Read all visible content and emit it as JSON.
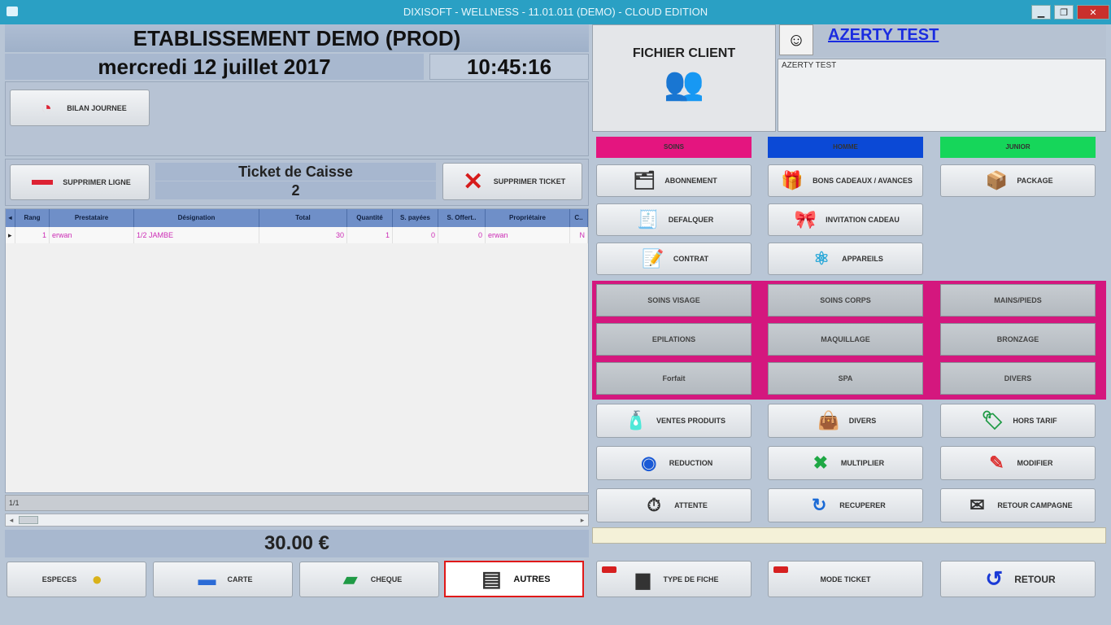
{
  "window": {
    "title": "DIXISOFT - WELLNESS - 11.01.011 (DEMO) - CLOUD EDITION",
    "minimize_icon": "minimize-icon",
    "maximize_icon": "maximize-icon",
    "close_icon": "close-icon"
  },
  "header": {
    "establishment": "ETABLISSEMENT DEMO (PROD)",
    "date": "mercredi 12 juillet 2017",
    "time": "10:45:16",
    "bilan_label": "BILAN JOURNEE"
  },
  "ticket": {
    "delete_line_label": "SUPPRIMER LIGNE",
    "title": "Ticket de Caisse",
    "number": "2",
    "delete_ticket_label": "SUPPRIMER TICKET"
  },
  "grid": {
    "columns": [
      "Rang",
      "Prestataire",
      "Désignation",
      "Total",
      "Quantité",
      "S. payées",
      "S. Offert..",
      "Propriétaire",
      "C.."
    ],
    "rows": [
      [
        "1",
        "erwan",
        "1/2 JAMBE",
        "30",
        "1",
        "0",
        "0",
        "erwan",
        "N"
      ]
    ],
    "footer": "1/1"
  },
  "total": "30.00 €",
  "payments": [
    {
      "label": "ESPECES",
      "icon": "coins-icon"
    },
    {
      "label": "CARTE",
      "icon": "card-icon"
    },
    {
      "label": "CHEQUE",
      "icon": "cheque-icon"
    },
    {
      "label": "AUTRES",
      "icon": "wallet-icon"
    }
  ],
  "client": {
    "fichier_label": "FICHIER CLIENT",
    "name": "AZERTY TEST",
    "info_line": "AZERTY    TEST"
  },
  "categories": [
    {
      "label": "SOINS",
      "color": "#e4157f"
    },
    {
      "label": "HOMME",
      "color": "#0b49d6"
    },
    {
      "label": "JUNIOR",
      "color": "#16d65a"
    }
  ],
  "actions_top": [
    {
      "label": "ABONNEMENT",
      "icon": "subscription-icon"
    },
    {
      "label": "BONS CADEAUX / AVANCES",
      "icon": "gift-icon"
    },
    {
      "label": "PACKAGE",
      "icon": "package-icon"
    },
    {
      "label": "DEFALQUER",
      "icon": "deduct-icon"
    },
    {
      "label": "INVITATION CADEAU",
      "icon": "invitation-icon"
    },
    {
      "label": "CONTRAT",
      "icon": "contract-icon"
    },
    {
      "label": "APPAREILS",
      "icon": "device-icon"
    }
  ],
  "soins_grid": [
    "SOINS VISAGE",
    "SOINS CORPS",
    "MAINS/PIEDS",
    "EPILATIONS",
    "MAQUILLAGE",
    "BRONZAGE",
    "Forfait",
    "SPA",
    "DIVERS"
  ],
  "actions_bottom": [
    {
      "label": "VENTES PRODUITS",
      "icon": "products-icon"
    },
    {
      "label": "DIVERS",
      "icon": "misc-icon"
    },
    {
      "label": "HORS TARIF",
      "icon": "offprice-icon"
    },
    {
      "label": "REDUCTION",
      "icon": "discount-icon"
    },
    {
      "label": "MULTIPLIER",
      "icon": "multiply-icon"
    },
    {
      "label": "MODIFIER",
      "icon": "edit-icon"
    },
    {
      "label": "ATTENTE",
      "icon": "wait-icon"
    },
    {
      "label": "RECUPERER",
      "icon": "retrieve-icon"
    },
    {
      "label": "RETOUR CAMPAGNE",
      "icon": "campaign-icon"
    }
  ],
  "footer_actions": [
    {
      "label": "TYPE DE FICHE",
      "icon": "card-type-icon"
    },
    {
      "label": "MODE TICKET",
      "icon": "ticket-mode-icon"
    },
    {
      "label": "RETOUR",
      "icon": "return-icon"
    }
  ]
}
